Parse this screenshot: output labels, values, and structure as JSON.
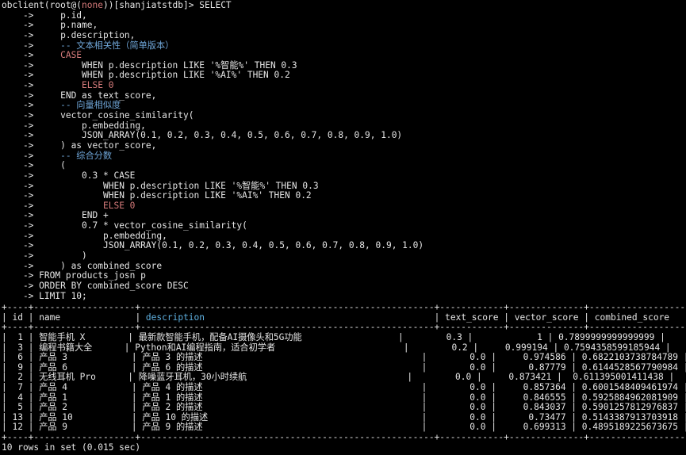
{
  "prompt": {
    "prefix": "obclient(root@(",
    "user": "none",
    "suffix": "))[shanjiatstdb]> ",
    "first_cmd": "SELECT"
  },
  "continuation": "    ->",
  "sql_lines": [
    "     p.id,",
    "     p.name,",
    "     p.description,",
    "     -- 文本相关性（简单版本）",
    "     CASE",
    "         WHEN p.description LIKE '%智能%' THEN 0.3",
    "         WHEN p.description LIKE '%AI%' THEN 0.2",
    "         ELSE 0",
    "     END as text_score,",
    "     -- 向量相似度",
    "     vector_cosine_similarity(",
    "         p.embedding,",
    "         JSON_ARRAY(0.1, 0.2, 0.3, 0.4, 0.5, 0.6, 0.7, 0.8, 0.9, 1.0)",
    "     ) as vector_score,",
    "     -- 综合分数",
    "     (",
    "         0.3 * CASE",
    "             WHEN p.description LIKE '%智能%' THEN 0.3",
    "             WHEN p.description LIKE '%AI%' THEN 0.2",
    "             ELSE 0",
    "         END +",
    "         0.7 * vector_cosine_similarity(",
    "             p.embedding,",
    "             JSON_ARRAY(0.1, 0.2, 0.3, 0.4, 0.5, 0.6, 0.7, 0.8, 0.9, 1.0)",
    "         )",
    "     ) as combined_score",
    " FROM products_josn p",
    " ORDER BY combined_score DESC",
    " LIMIT 10;"
  ],
  "table": {
    "border": "+----+-------------------+-------------------------------------------------------+------------+--------------+--------------------+",
    "columns": [
      "id",
      "name",
      "description",
      "text_score",
      "vector_score",
      "combined_score"
    ],
    "rows": [
      [
        "1",
        "智能手机 X",
        "最新款智能手机，配备AI摄像头和5G功能",
        "0.3",
        "1",
        "0.7899999999999999"
      ],
      [
        "3",
        "编程书籍大全",
        "Python和AI编程指南，适合初学者",
        "0.2",
        "0.999194",
        "0.7594358599185944"
      ],
      [
        "6",
        "产品 3",
        "产品 3 的描述",
        "0.0",
        "0.974586",
        "0.6822103738784789"
      ],
      [
        "9",
        "产品 6",
        "产品 6 的描述",
        "0.0",
        "0.87779",
        "0.6144528567790984"
      ],
      [
        "2",
        "无线耳机 Pro",
        "降噪蓝牙耳机，30小时续航",
        "0.0",
        "0.873421",
        "0.611395001411438"
      ],
      [
        "7",
        "产品 4",
        "产品 4 的描述",
        "0.0",
        "0.857364",
        "0.6001548409461974"
      ],
      [
        "4",
        "产品 1",
        "产品 1 的描述",
        "0.0",
        "0.846555",
        "0.5925884962081909"
      ],
      [
        "5",
        "产品 2",
        "产品 2 的描述",
        "0.0",
        "0.843037",
        "0.5901257812976837"
      ],
      [
        "13",
        "产品 10",
        "产品 10 的描述",
        "0.0",
        "0.73477",
        "0.5143387913703918"
      ],
      [
        "12",
        "产品 9",
        "产品 9 的描述",
        "0.0",
        "0.699313",
        "0.4895189225673675"
      ]
    ]
  },
  "result_summary": "10 rows in set (0.015 sec)",
  "colors": {
    "background": "#000000",
    "text": "#e6e6e6",
    "keyword": "#d67b7b",
    "comment": "#6fa6d8",
    "description_header": "#5fb0e0"
  }
}
